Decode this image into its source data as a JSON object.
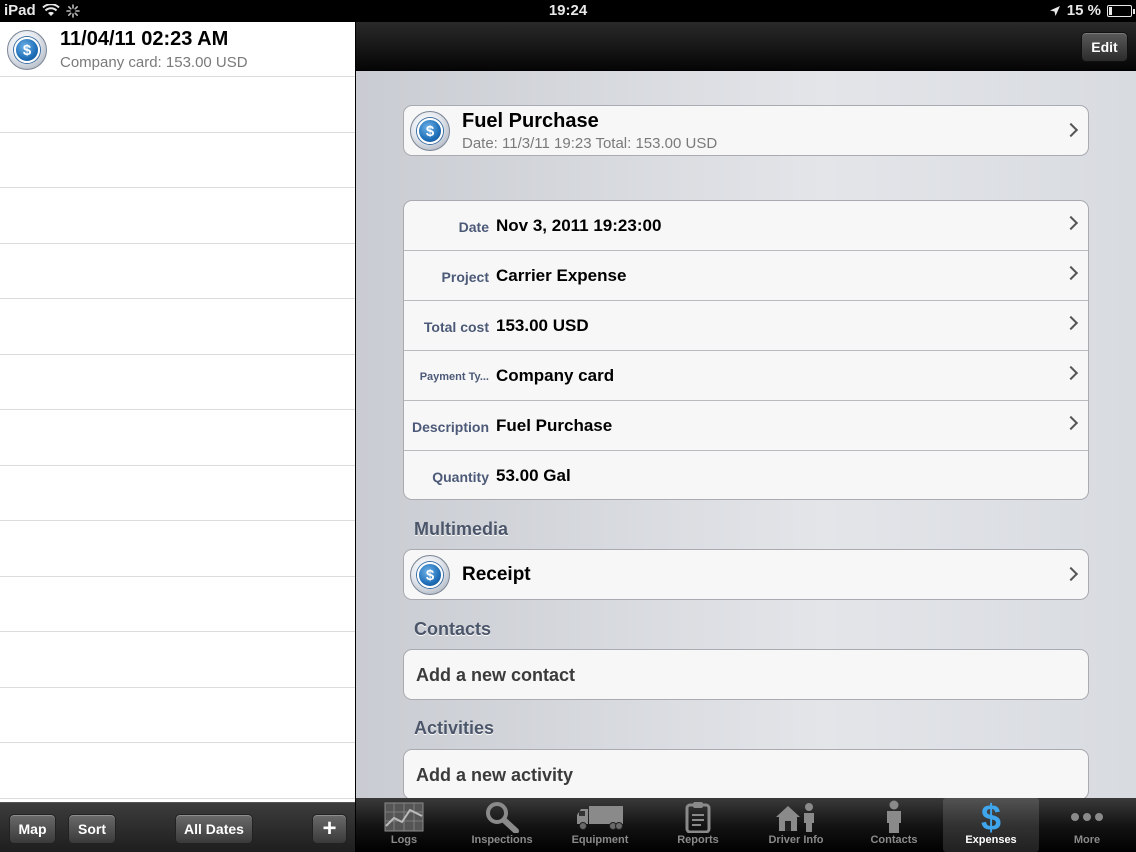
{
  "status_bar": {
    "device": "iPad",
    "time": "19:24",
    "battery_percent": "15 %",
    "battery_level": 0.15
  },
  "list": {
    "items": [
      {
        "title": "11/04/11 02:23 AM",
        "subtitle": "Company card: 153.00 USD",
        "icon": "dollar-coin-icon"
      }
    ]
  },
  "left_toolbar": {
    "map_label": "Map",
    "sort_label": "Sort",
    "dates_label": "All Dates",
    "add_label": "+"
  },
  "navbar": {
    "edit_label": "Edit"
  },
  "detail": {
    "header": {
      "title": "Fuel Purchase",
      "subtitle": "Date: 11/3/11 19:23 Total: 153.00 USD"
    },
    "fields": [
      {
        "label": "Date",
        "value": "Nov 3, 2011 19:23:00",
        "has_chevron": true
      },
      {
        "label": "Project",
        "value": "Carrier Expense",
        "has_chevron": true
      },
      {
        "label": "Total cost",
        "value": "153.00 USD",
        "has_chevron": true
      },
      {
        "label": "Payment Ty...",
        "value": "Company card",
        "has_chevron": true
      },
      {
        "label": "Description",
        "value": "Fuel Purchase",
        "has_chevron": true
      },
      {
        "label": "Quantity",
        "value": "53.00 Gal",
        "has_chevron": false
      }
    ],
    "multimedia": {
      "section_title": "Multimedia",
      "item_label": "Receipt"
    },
    "contacts": {
      "section_title": "Contacts",
      "add_label": "Add a new contact"
    },
    "activities": {
      "section_title": "Activities",
      "add_label": "Add a new activity"
    }
  },
  "tabbar": {
    "tabs": [
      {
        "label": "Logs",
        "icon": "chart-icon"
      },
      {
        "label": "Inspections",
        "icon": "magnifier-icon"
      },
      {
        "label": "Equipment",
        "icon": "truck-icon"
      },
      {
        "label": "Reports",
        "icon": "clipboard-icon"
      },
      {
        "label": "Driver Info",
        "icon": "house-person-icon"
      },
      {
        "label": "Contacts",
        "icon": "person-icon"
      },
      {
        "label": "Expenses",
        "icon": "dollar-icon"
      },
      {
        "label": "More",
        "icon": "ellipsis-icon"
      }
    ],
    "active": "Expenses"
  },
  "colors": {
    "accent_blue": "#1f6fb8",
    "label_blue": "#4c5a78",
    "active_tab": "#3fa6ee"
  }
}
